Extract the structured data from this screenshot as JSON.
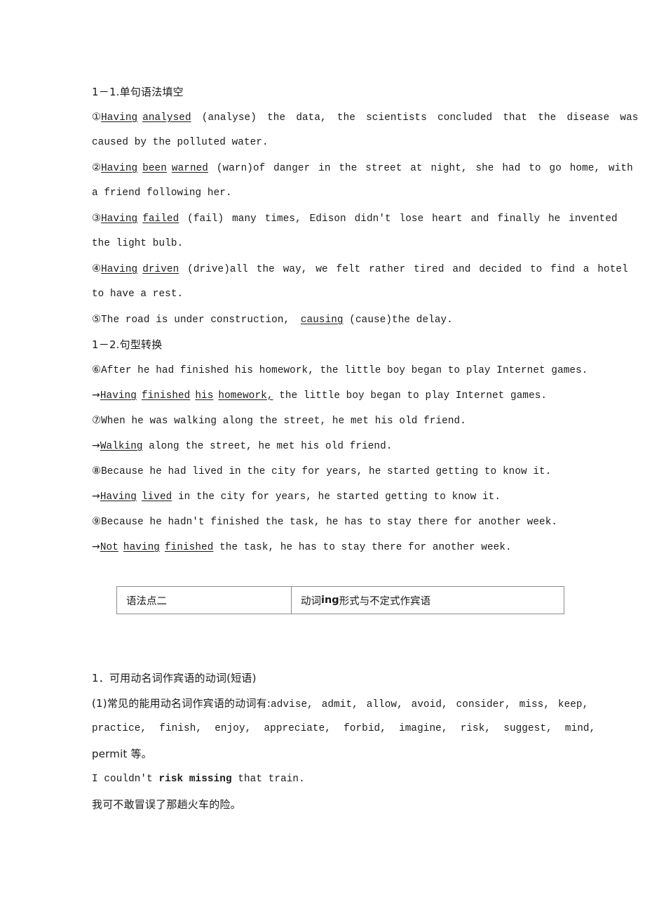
{
  "document": {
    "type": "grammar-worksheet-page",
    "language": "zh-CN + en",
    "sections": [
      {
        "heading": "1－1.单句语法填空",
        "items": [
          {
            "number": "①",
            "answer_parts": [
              "Having",
              "analysed"
            ],
            "rest": " (analyse) the data,  the scientists concluded that the disease was",
            "continuation": "caused by the polluted water."
          },
          {
            "number": "②",
            "answer_parts": [
              "Having",
              "been",
              "warned"
            ],
            "rest": " (warn)of danger in the street at night,  she had to go home,  with",
            "continuation": "a friend following her."
          },
          {
            "number": "③",
            "answer_parts": [
              "Having",
              "failed"
            ],
            "rest": " (fail) many times,  Edison didn't lose heart and finally he invented",
            "continuation": "the light bulb."
          },
          {
            "number": "④",
            "answer_parts": [
              "Having",
              "driven"
            ],
            "rest": " (drive)all the way,  we felt rather tired and decided to find a hotel",
            "continuation": "to have a rest."
          },
          {
            "number": "⑤",
            "prefix": "The road is under construction,  ",
            "answer_parts": [
              "causing"
            ],
            "rest": " (cause)the delay.",
            "continuation": ""
          }
        ]
      },
      {
        "heading": "1－2.句型转换",
        "items": [
          {
            "number": "⑥",
            "original": "After he had finished his homework, the little boy began to play Internet games.",
            "arrow": "→",
            "answer_parts": [
              "Having",
              "finished",
              "his",
              "homework,"
            ],
            "answer_rest": "  the little boy began to play Internet games."
          },
          {
            "number": "⑦",
            "original": "When he was walking along the street,  he met his old friend.",
            "arrow": "→",
            "answer_parts": [
              "Walking"
            ],
            "answer_rest": " along the street,  he met his old friend."
          },
          {
            "number": "⑧",
            "original": "Because he had lived in the city for years,  he started getting to know it.",
            "arrow": "→",
            "answer_parts": [
              "Having",
              "lived"
            ],
            "answer_rest": " in the city for years,  he started getting to know it."
          },
          {
            "number": "⑨",
            "original": "Because he hadn't finished the task,  he has to stay there for another week.",
            "arrow": "→",
            "answer_parts": [
              "Not",
              "having",
              "finished"
            ],
            "answer_rest": " the task,  he has to stay there for another week."
          }
        ]
      }
    ],
    "grammar_box": {
      "left_label": "语法点二",
      "right_label_pre": "动词",
      "right_label_bold": "ing",
      "right_label_post": " 形式与不定式作宾语"
    },
    "section_two": {
      "title": "1．可用动名词作宾语的动词(短语)",
      "subtitle_prefix": "(1)常见的能用动名词作宾语的动词有:",
      "verbs_line1": "advise,  admit,  allow,  avoid,  consider,  miss,  keep,",
      "verbs_line2": "practice,  finish,  enjoy,  appreciate,  forbid,  imagine,  risk,  suggest,  mind,",
      "verbs_line3": "permit 等。",
      "example_pre": "I couldn't ",
      "example_bold": "risk missing",
      "example_post": " that train.",
      "example_translation": "我可不敢冒误了那趟火车的险。"
    }
  }
}
